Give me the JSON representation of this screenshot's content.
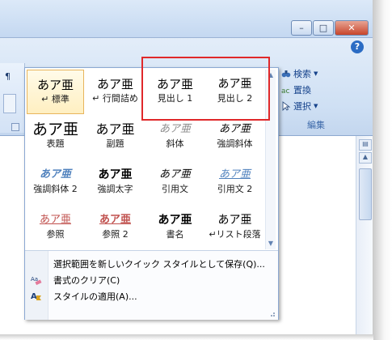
{
  "window": {
    "minimize": "–",
    "maximize": "□",
    "close": "✕",
    "help": "?"
  },
  "ribbon": {
    "edit_group": {
      "items": [
        {
          "label": "検索",
          "icon": "binoculars-icon"
        },
        {
          "label": "置換",
          "icon": "replace-icon"
        },
        {
          "label": "選択",
          "icon": "select-arrow-icon"
        }
      ],
      "caption": "編集"
    }
  },
  "gallery": {
    "styles": [
      {
        "sample": "あア亜",
        "label": "↵ 標準",
        "selected": true
      },
      {
        "sample": "あア亜",
        "label": "↵ 行間詰め"
      },
      {
        "sample": "あア亜",
        "label": "見出し 1"
      },
      {
        "sample": "あア亜",
        "label": "見出し 2"
      },
      {
        "sample": "あア亜",
        "label": "表題"
      },
      {
        "sample": "あア亜",
        "label": "副題"
      },
      {
        "sample": "あア亜",
        "label": "斜体"
      },
      {
        "sample": "あア亜",
        "label": "強調斜体"
      },
      {
        "sample": "あア亜",
        "label": "強調斜体 2"
      },
      {
        "sample": "あア亜",
        "label": "強調太字"
      },
      {
        "sample": "あア亜",
        "label": "引用文"
      },
      {
        "sample": "あア亜",
        "label": "引用文 2"
      },
      {
        "sample": "あア亜",
        "label": "参照"
      },
      {
        "sample": "あア亜",
        "label": "参照 2"
      },
      {
        "sample": "あア亜",
        "label": "書名"
      },
      {
        "sample": "あア亜",
        "label": "↵リスト段落"
      }
    ],
    "menu": [
      {
        "label": "選択範囲を新しいクイック スタイルとして保存(Q)...",
        "icon": "none"
      },
      {
        "label": "書式のクリア(C)",
        "icon": "clear-format-icon"
      },
      {
        "label": "スタイルの適用(A)...",
        "icon": "apply-styles-icon"
      }
    ]
  },
  "colors": {
    "highlight": "#e0282a",
    "selected_bg": "#ffefc1",
    "accent": "#15428b"
  }
}
